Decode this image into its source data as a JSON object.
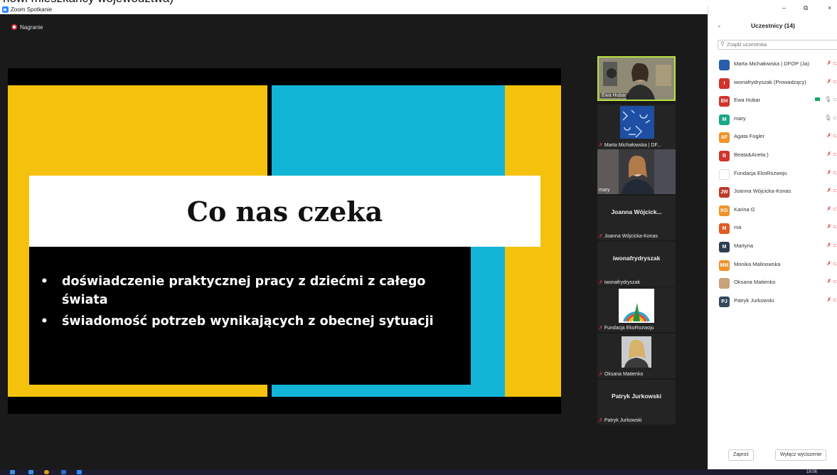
{
  "crop_text": "nowi mieszkańcy województwa)",
  "window": {
    "title": "Zoom Spotkanie",
    "recording_label": "Nagranie",
    "controls": [
      "–",
      "⧉",
      "×"
    ]
  },
  "slide": {
    "title": "Co nas czeka",
    "bullets": [
      "doświadczenie praktycznej pracy z dziećmi z całego świata",
      "świadomość potrzeb wynikających z obecnej sytuacji"
    ],
    "colors": {
      "yellow": "#f4c20d",
      "blue": "#13b5d6",
      "black": "#000000"
    }
  },
  "videos": [
    {
      "name": "Ewa Hubar",
      "type": "video",
      "muted": false,
      "active": true
    },
    {
      "name": "Marta Michałowska | DF...",
      "type": "pattern",
      "muted": true
    },
    {
      "name": "mary",
      "type": "video",
      "muted": false
    },
    {
      "name": "Joanna Wójcicka-Konas",
      "center_label": "Joanna  Wójcick...",
      "type": "name",
      "muted": true
    },
    {
      "name": "iwonafrydryszak",
      "center_label": "iwonafrydryszak",
      "type": "name",
      "muted": true
    },
    {
      "name": "Fundacja EkoRozwoju",
      "type": "logo",
      "muted": true
    },
    {
      "name": "Oksana Matienko",
      "type": "photo",
      "muted": true
    },
    {
      "name": "Patryk Jurkowski",
      "center_label": "Patryk Jurkowski",
      "type": "name",
      "muted": true
    }
  ],
  "panel": {
    "title": "Uczestnicy (14)",
    "search_placeholder": "Znajdź uczestnika",
    "participants": [
      {
        "initials": "",
        "name": "Marta Michałowska | DFOP (Ja)",
        "color": "#2a5ea8",
        "status": "muted"
      },
      {
        "initials": "I",
        "name": "iwonafrydryszak (Prowadzący)",
        "color": "#d0342c",
        "status": "muted"
      },
      {
        "initials": "EH",
        "name": "Ewa Hubar",
        "color": "#d0342c",
        "status": "video"
      },
      {
        "initials": "M",
        "name": "mary",
        "color": "#1aa78a",
        "status": "mic"
      },
      {
        "initials": "AF",
        "name": "Agata Fogler",
        "color": "#f0932a",
        "status": "muted"
      },
      {
        "initials": "B",
        "name": "Beata&Aneta:)",
        "color": "#d0342c",
        "status": "muted"
      },
      {
        "initials": "",
        "name": "Fundacja EkoRozwoju",
        "color": "#ffffff",
        "status": "muted"
      },
      {
        "initials": "JW",
        "name": "Joanna Wójcicka-Konas",
        "color": "#c0392b",
        "status": "muted"
      },
      {
        "initials": "KG",
        "name": "Karina G",
        "color": "#f0932a",
        "status": "muted"
      },
      {
        "initials": "M",
        "name": "ma",
        "color": "#e05a22",
        "status": "muted"
      },
      {
        "initials": "M",
        "name": "Martyna",
        "color": "#2c3e50",
        "status": "muted"
      },
      {
        "initials": "MM",
        "name": "Monika Malinowska",
        "color": "#f0932a",
        "status": "muted"
      },
      {
        "initials": "",
        "name": "Oksana Matienko",
        "color": "#c9a27a",
        "status": "muted"
      },
      {
        "initials": "PJ",
        "name": "Patryk Jurkowski",
        "color": "#34495e",
        "status": "muted"
      }
    ],
    "invite_label": "Zaproś",
    "mute_all_label": "Wyłącz wyciszenie"
  },
  "taskbar": {
    "time": "18:06"
  }
}
